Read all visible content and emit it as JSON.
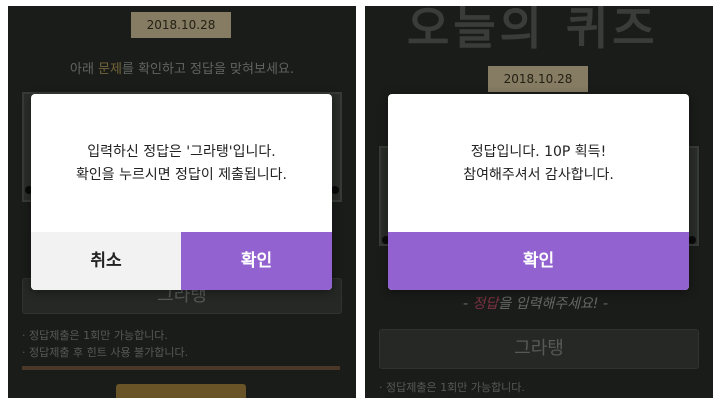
{
  "left": {
    "date": "2018.10.28",
    "instruction_pre": "아래 ",
    "instruction_highlight": "문제",
    "instruction_post": "를 확인하고 정답을 맞혀보세요.",
    "input_value": "그라탱",
    "notes": [
      "· 정답제출은 1회만 가능합니다.",
      "· 정답제출 후 힌트 사용 불가합니다."
    ],
    "dialog": {
      "message_line1": "입력하신 정답은 '그라탱'입니다.",
      "message_line2": "확인을 누르시면 정답이 제출됩니다.",
      "cancel_label": "취소",
      "ok_label": "확인"
    }
  },
  "right": {
    "title": "오늘의 퀴즈",
    "date": "2018.10.28",
    "hand_pre": "- ",
    "hand_red": "정답",
    "hand_post": "을 입력해주세요! -",
    "input_value": "그라탱",
    "note": "· 정답제출은 1회만 가능합니다.",
    "dialog": {
      "message_line1": "정답입니다. 10P 획득!",
      "message_line2": "참여해주셔서 감사합니다.",
      "ok_label": "확인"
    }
  },
  "colors": {
    "accent_purple": "#9262d0",
    "background": "#2a2e2a",
    "ribbon": "#d8c9a0"
  }
}
